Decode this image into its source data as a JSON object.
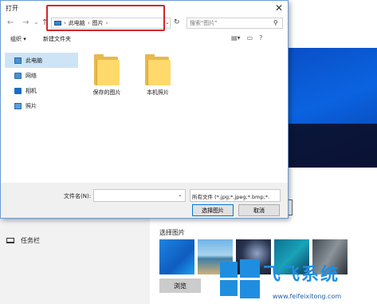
{
  "dialog": {
    "title": "打开",
    "close_glyph": "✕",
    "nav": {
      "back": "←",
      "forward": "→",
      "recent": "⌄",
      "up": "↑"
    },
    "breadcrumb": [
      "此电脑",
      "图片"
    ],
    "breadcrumb_sep": "›",
    "search_placeholder": "搜索\"图片\"",
    "toolbar": {
      "organize": "组织 ▾",
      "new_folder": "新建文件夹"
    },
    "sidebar": [
      {
        "label": "此电脑",
        "icon": "computer-icon",
        "selected": true
      },
      {
        "label": "网络",
        "icon": "network-icon"
      },
      {
        "label": "相机",
        "icon": "camera-icon"
      },
      {
        "label": "照片",
        "icon": "photos-icon"
      }
    ],
    "folders": [
      {
        "name": "保存的图片"
      },
      {
        "name": "本机照片"
      }
    ],
    "filename_label": "文件名(N):",
    "filename_value": "",
    "filter_value": "所有文件 (*.jpg;*.jpeg;*.bmp;*.",
    "open_button": "选择图片",
    "cancel_button": "取消"
  },
  "settings": {
    "taskbar_label": "任务栏",
    "choose_picture_label": "选择图片",
    "browse_button": "浏览"
  },
  "watermark": {
    "text": "飞飞系统",
    "url": "www.feifeixitong.com"
  },
  "colors": {
    "accent": "#0078d7",
    "highlight_box": "#d6232a",
    "watermark": "#1f8ee0"
  }
}
